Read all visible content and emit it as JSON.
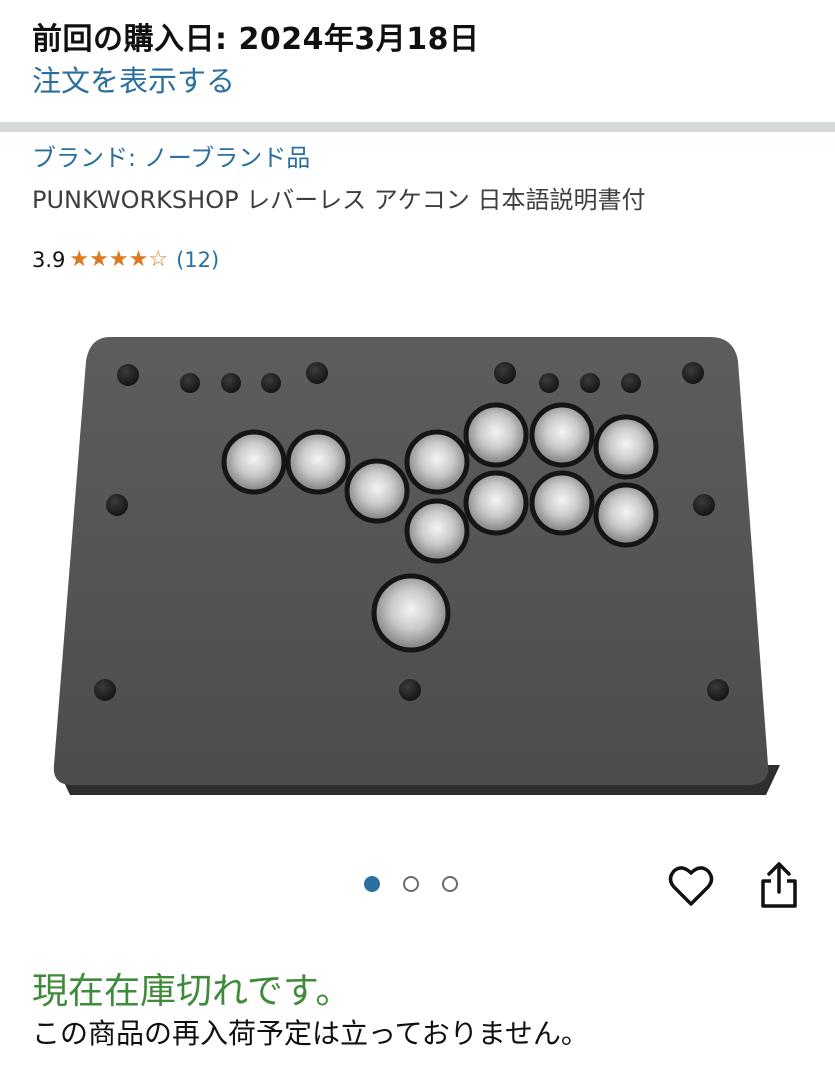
{
  "purchase": {
    "title": "前回の購入日: 2024年3月18日",
    "view_order_link": "注文を表示する"
  },
  "product": {
    "brand_link": "ブランド: ノーブランド品",
    "title": "PUNKWORKSHOP レバーレス アケコン 日本語説明書付",
    "rating": "3.9",
    "stars": 3.9,
    "review_count": "(12)",
    "image_icon": "leverless-arcade-controller"
  },
  "gallery": {
    "dot_count": 3,
    "active_index": 0
  },
  "actions": {
    "favorite_icon": "heart-icon",
    "share_icon": "share-icon"
  },
  "availability": {
    "status": "現在在庫切れです。",
    "restock_note": "この商品の再入荷予定は立っておりません。"
  },
  "colors": {
    "link": "#2a6f9e",
    "star": "#de7921",
    "in_stock_green": "#3f8b3a",
    "divider": "#d5d9d9"
  }
}
